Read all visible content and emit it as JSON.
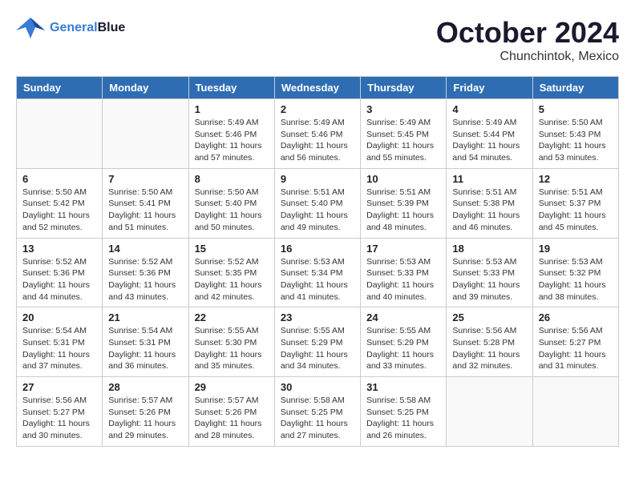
{
  "header": {
    "logo_line1": "General",
    "logo_line2": "Blue",
    "month": "October 2024",
    "location": "Chunchintok, Mexico"
  },
  "weekdays": [
    "Sunday",
    "Monday",
    "Tuesday",
    "Wednesday",
    "Thursday",
    "Friday",
    "Saturday"
  ],
  "weeks": [
    [
      {
        "day": "",
        "info": ""
      },
      {
        "day": "",
        "info": ""
      },
      {
        "day": "1",
        "info": "Sunrise: 5:49 AM\nSunset: 5:46 PM\nDaylight: 11 hours\nand 57 minutes."
      },
      {
        "day": "2",
        "info": "Sunrise: 5:49 AM\nSunset: 5:46 PM\nDaylight: 11 hours\nand 56 minutes."
      },
      {
        "day": "3",
        "info": "Sunrise: 5:49 AM\nSunset: 5:45 PM\nDaylight: 11 hours\nand 55 minutes."
      },
      {
        "day": "4",
        "info": "Sunrise: 5:49 AM\nSunset: 5:44 PM\nDaylight: 11 hours\nand 54 minutes."
      },
      {
        "day": "5",
        "info": "Sunrise: 5:50 AM\nSunset: 5:43 PM\nDaylight: 11 hours\nand 53 minutes."
      }
    ],
    [
      {
        "day": "6",
        "info": "Sunrise: 5:50 AM\nSunset: 5:42 PM\nDaylight: 11 hours\nand 52 minutes."
      },
      {
        "day": "7",
        "info": "Sunrise: 5:50 AM\nSunset: 5:41 PM\nDaylight: 11 hours\nand 51 minutes."
      },
      {
        "day": "8",
        "info": "Sunrise: 5:50 AM\nSunset: 5:40 PM\nDaylight: 11 hours\nand 50 minutes."
      },
      {
        "day": "9",
        "info": "Sunrise: 5:51 AM\nSunset: 5:40 PM\nDaylight: 11 hours\nand 49 minutes."
      },
      {
        "day": "10",
        "info": "Sunrise: 5:51 AM\nSunset: 5:39 PM\nDaylight: 11 hours\nand 48 minutes."
      },
      {
        "day": "11",
        "info": "Sunrise: 5:51 AM\nSunset: 5:38 PM\nDaylight: 11 hours\nand 46 minutes."
      },
      {
        "day": "12",
        "info": "Sunrise: 5:51 AM\nSunset: 5:37 PM\nDaylight: 11 hours\nand 45 minutes."
      }
    ],
    [
      {
        "day": "13",
        "info": "Sunrise: 5:52 AM\nSunset: 5:36 PM\nDaylight: 11 hours\nand 44 minutes."
      },
      {
        "day": "14",
        "info": "Sunrise: 5:52 AM\nSunset: 5:36 PM\nDaylight: 11 hours\nand 43 minutes."
      },
      {
        "day": "15",
        "info": "Sunrise: 5:52 AM\nSunset: 5:35 PM\nDaylight: 11 hours\nand 42 minutes."
      },
      {
        "day": "16",
        "info": "Sunrise: 5:53 AM\nSunset: 5:34 PM\nDaylight: 11 hours\nand 41 minutes."
      },
      {
        "day": "17",
        "info": "Sunrise: 5:53 AM\nSunset: 5:33 PM\nDaylight: 11 hours\nand 40 minutes."
      },
      {
        "day": "18",
        "info": "Sunrise: 5:53 AM\nSunset: 5:33 PM\nDaylight: 11 hours\nand 39 minutes."
      },
      {
        "day": "19",
        "info": "Sunrise: 5:53 AM\nSunset: 5:32 PM\nDaylight: 11 hours\nand 38 minutes."
      }
    ],
    [
      {
        "day": "20",
        "info": "Sunrise: 5:54 AM\nSunset: 5:31 PM\nDaylight: 11 hours\nand 37 minutes."
      },
      {
        "day": "21",
        "info": "Sunrise: 5:54 AM\nSunset: 5:31 PM\nDaylight: 11 hours\nand 36 minutes."
      },
      {
        "day": "22",
        "info": "Sunrise: 5:55 AM\nSunset: 5:30 PM\nDaylight: 11 hours\nand 35 minutes."
      },
      {
        "day": "23",
        "info": "Sunrise: 5:55 AM\nSunset: 5:29 PM\nDaylight: 11 hours\nand 34 minutes."
      },
      {
        "day": "24",
        "info": "Sunrise: 5:55 AM\nSunset: 5:29 PM\nDaylight: 11 hours\nand 33 minutes."
      },
      {
        "day": "25",
        "info": "Sunrise: 5:56 AM\nSunset: 5:28 PM\nDaylight: 11 hours\nand 32 minutes."
      },
      {
        "day": "26",
        "info": "Sunrise: 5:56 AM\nSunset: 5:27 PM\nDaylight: 11 hours\nand 31 minutes."
      }
    ],
    [
      {
        "day": "27",
        "info": "Sunrise: 5:56 AM\nSunset: 5:27 PM\nDaylight: 11 hours\nand 30 minutes."
      },
      {
        "day": "28",
        "info": "Sunrise: 5:57 AM\nSunset: 5:26 PM\nDaylight: 11 hours\nand 29 minutes."
      },
      {
        "day": "29",
        "info": "Sunrise: 5:57 AM\nSunset: 5:26 PM\nDaylight: 11 hours\nand 28 minutes."
      },
      {
        "day": "30",
        "info": "Sunrise: 5:58 AM\nSunset: 5:25 PM\nDaylight: 11 hours\nand 27 minutes."
      },
      {
        "day": "31",
        "info": "Sunrise: 5:58 AM\nSunset: 5:25 PM\nDaylight: 11 hours\nand 26 minutes."
      },
      {
        "day": "",
        "info": ""
      },
      {
        "day": "",
        "info": ""
      }
    ]
  ]
}
